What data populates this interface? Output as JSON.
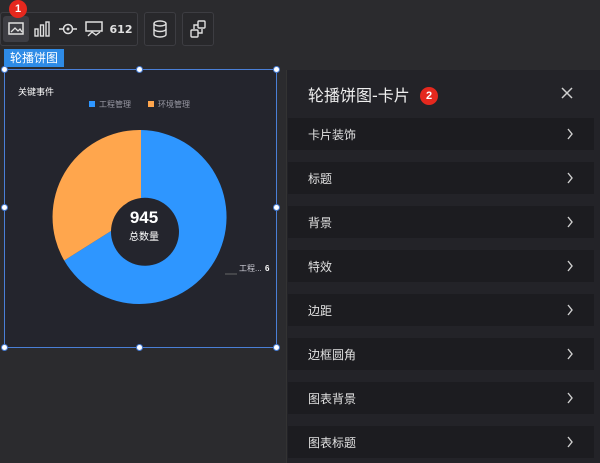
{
  "toolbar": {
    "tools": [
      {
        "name": "image-tool",
        "icon": "image-icon"
      },
      {
        "name": "bar-chart-tool",
        "icon": "bar-chart-icon"
      },
      {
        "name": "eye-tool",
        "icon": "eye-icon"
      },
      {
        "name": "display-tool",
        "icon": "display-icon"
      },
      {
        "name": "number-tool",
        "label": "612"
      }
    ],
    "data_icon": "database-icon",
    "link_icon": "link-icon"
  },
  "callouts": {
    "one": "1",
    "two": "2"
  },
  "component_tag": "轮播饼图",
  "widget": {
    "title": "关键事件",
    "center_value": "945",
    "center_label": "总数量",
    "slice_label": "工程...",
    "slice_value": "6"
  },
  "chart_data": {
    "type": "pie",
    "title": "关键事件",
    "series": [
      {
        "name": "工程管理",
        "color": "#2e96ff"
      },
      {
        "name": "环境管理",
        "color": "#ffa64d"
      }
    ],
    "values": [
      0.75,
      0.25
    ],
    "total": 945
  },
  "panel": {
    "title": "轮播饼图-卡片",
    "sections": [
      "卡片装饰",
      "标题",
      "背景",
      "特效",
      "边距",
      "边框圆角",
      "图表背景",
      "图表标题"
    ]
  },
  "colors": {
    "accent": "#2e8be6",
    "badge": "#e5281e",
    "series1": "#2e96ff",
    "series2": "#ffa64d"
  }
}
